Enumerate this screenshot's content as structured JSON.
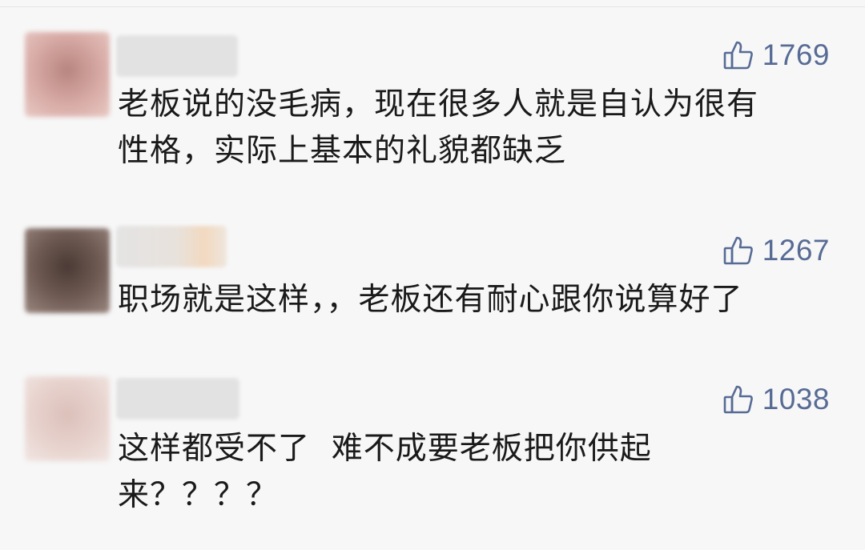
{
  "comments": [
    {
      "likes": "1769",
      "text_lines": [
        "老板说的没毛病，现在很多人就是自认为很有",
        "性格，实际上基本的礼貌都缺乏"
      ],
      "avatar_color": "#c79a95"
    },
    {
      "likes": "1267",
      "text_lines": [
        "职场就是这样，，老板还有耐心跟你说算好了"
      ],
      "avatar_color": "#6e5a52"
    },
    {
      "likes": "1038",
      "text_lines": [
        "这样都受不了  难不成要老板把你供起",
        "来？？？？"
      ],
      "avatar_color": "#e3cdc8"
    }
  ],
  "colors": {
    "like": "#576b95",
    "background": "#f7f7f7",
    "text": "#1a1a1a"
  },
  "icons": {
    "like": "thumbs-up-icon"
  }
}
